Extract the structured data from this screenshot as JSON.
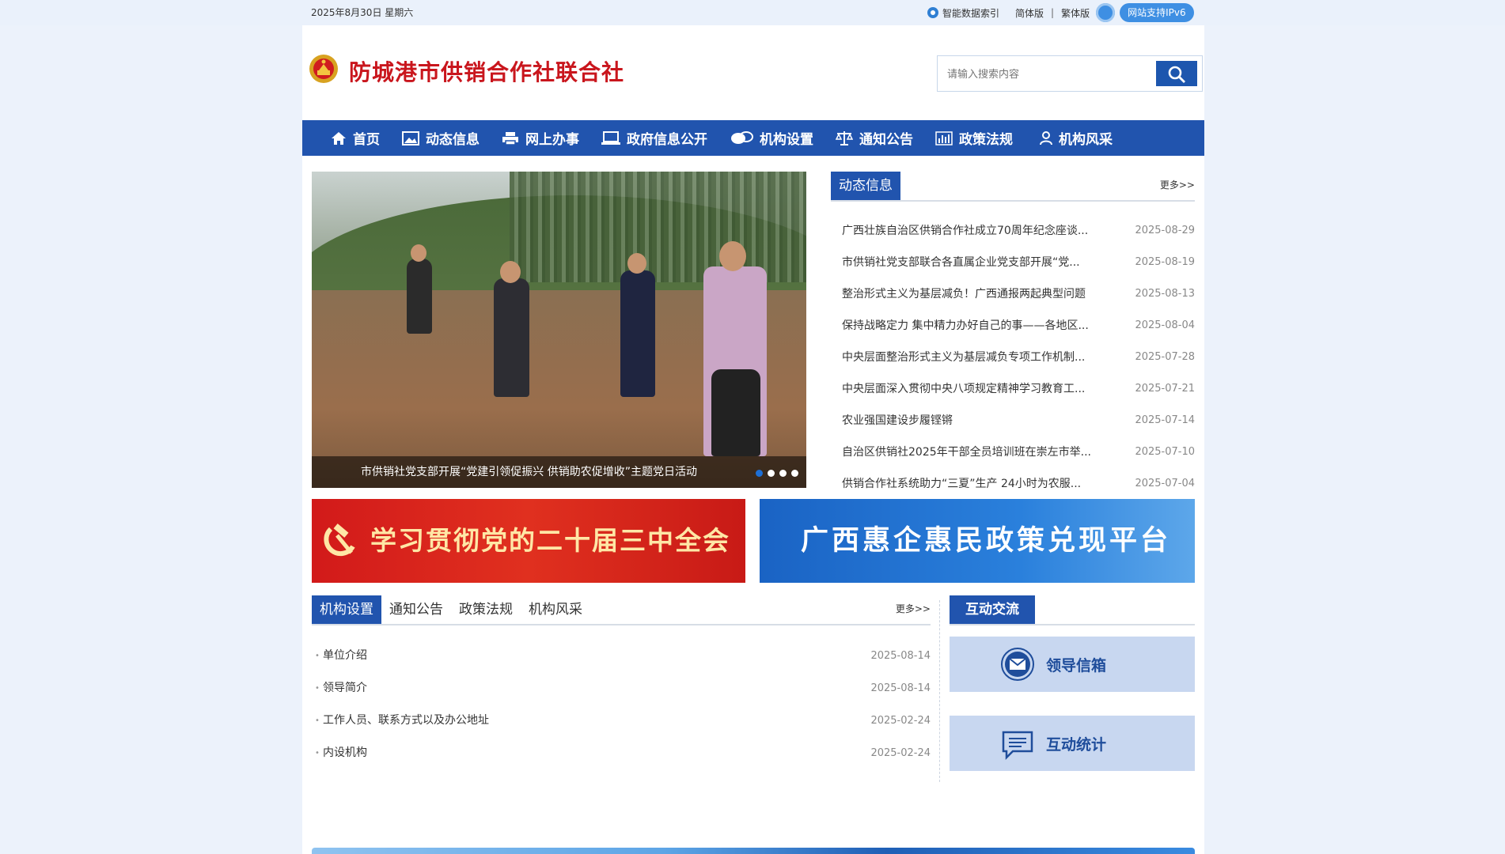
{
  "topbar": {
    "date": "2025年8月30日",
    "weekday": "星期六",
    "ai_search": "智能数据索引",
    "simplified": "简体版",
    "separator": "|",
    "traditional": "繁体版",
    "ipv6": "网站支持IPv6"
  },
  "header": {
    "site_title": "防城港市供销合作社联合社",
    "search_placeholder": "请输入搜索内容"
  },
  "nav": [
    {
      "label": "首页",
      "icon": "home-icon"
    },
    {
      "label": "动态信息",
      "icon": "image-icon"
    },
    {
      "label": "网上办事",
      "icon": "printer-icon"
    },
    {
      "label": "政府信息公开",
      "icon": "monitor-icon"
    },
    {
      "label": "机构设置",
      "icon": "chat-icon"
    },
    {
      "label": "通知公告",
      "icon": "scale-icon"
    },
    {
      "label": "政策法规",
      "icon": "bar-chart-icon"
    },
    {
      "label": "机构风采",
      "icon": "user-icon"
    }
  ],
  "slider": {
    "caption": "市供销社党支部开展“党建引领促振兴 供销助农促增收”主题党日活动",
    "dots": 4,
    "active_dot": 1
  },
  "news": {
    "tab": "动态信息",
    "more": "更多>>",
    "items": [
      {
        "title": "广西壮族自治区供销合作社成立70周年纪念座谈...",
        "date": "2025-08-29"
      },
      {
        "title": "市供销社党支部联合各直属企业党支部开展“党...",
        "date": "2025-08-19"
      },
      {
        "title": "整治形式主义为基层减负！广西通报两起典型问题",
        "date": "2025-08-13"
      },
      {
        "title": "保持战略定力 集中精力办好自己的事——各地区...",
        "date": "2025-08-04"
      },
      {
        "title": "中央层面整治形式主义为基层减负专项工作机制...",
        "date": "2025-07-28"
      },
      {
        "title": "中央层面深入贯彻中央八项规定精神学习教育工...",
        "date": "2025-07-21"
      },
      {
        "title": "农业强国建设步履铿锵",
        "date": "2025-07-14"
      },
      {
        "title": "自治区供销社2025年干部全员培训班在崇左市举...",
        "date": "2025-07-10"
      },
      {
        "title": "供销合作社系统助力“三夏”生产 24小时为农服...",
        "date": "2025-07-04"
      }
    ]
  },
  "banners": {
    "left": "学习贯彻党的二十届三中全会精神",
    "right": "广西惠企惠民政策兑现平台"
  },
  "org": {
    "tabs": [
      "机构设置",
      "通知公告",
      "政策法规",
      "机构风采"
    ],
    "more": "更多>>",
    "items": [
      {
        "title": "单位介绍",
        "date": "2025-08-14"
      },
      {
        "title": "领导简介",
        "date": "2025-08-14"
      },
      {
        "title": "工作人员、联系方式以及办公地址",
        "date": "2025-02-24"
      },
      {
        "title": "内设机构",
        "date": "2025-02-24"
      }
    ]
  },
  "interact": {
    "title": "互动交流",
    "mailbox": "领导信箱",
    "stats": "互动统计"
  },
  "colors": {
    "brand_blue": "#2154ae",
    "title_red": "#c9161d",
    "card_bg": "#c8d7f0"
  }
}
